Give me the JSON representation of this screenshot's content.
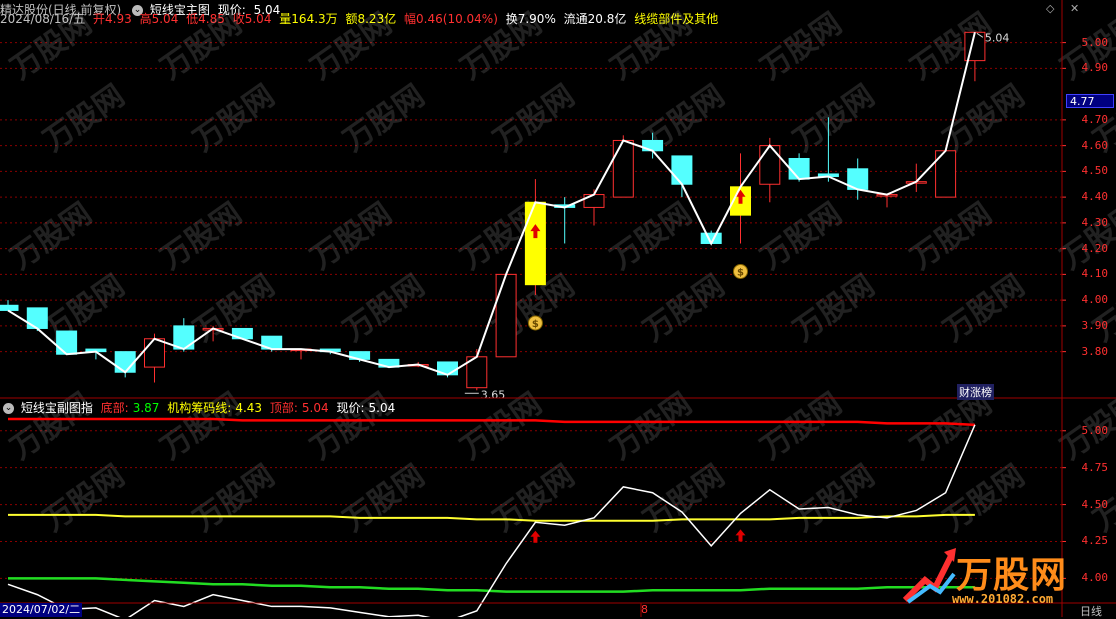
{
  "header": {
    "stock_title": "精达股份(日线,前复权)",
    "indicator_name": "短线宝主图",
    "price_label": "现价:",
    "price_value": "5.04",
    "date": "2024/08/16/五",
    "open": "开4.93",
    "high": "高5.04",
    "low": "低4.85",
    "close": "收5.04",
    "volume": "量164.3万",
    "amount": "额8.23亿",
    "change": "幅0.46(10.04%)",
    "turnover": "换7.90%",
    "float": "流通20.8亿",
    "section": "线缆部件及其他"
  },
  "sub_header": {
    "indicator_name": "短线宝副图指",
    "bottom_label": "底部:",
    "bottom_value": "3.87",
    "inst_label": "机构筹码线:",
    "inst_value": "4.43",
    "top_label": "顶部:",
    "top_value": "5.04",
    "price_label": "现价:",
    "price_value": "5.04"
  },
  "main_axis": [
    "5.00",
    "4.90",
    "4.77",
    "4.70",
    "4.60",
    "4.50",
    "4.40",
    "4.30",
    "4.20",
    "4.10",
    "4.00",
    "3.90",
    "3.80"
  ],
  "current_price_tag": "4.77",
  "sub_axis": [
    "5.00",
    "4.75",
    "4.50",
    "4.25",
    "4.00"
  ],
  "annotations": {
    "high_price": "5.04",
    "low_price": "3.65",
    "caizhang": "财涨榜",
    "date_start": "2024/07/02/二",
    "month_mark": "8",
    "period": "日线"
  },
  "watermark": {
    "brand": "万股网",
    "url": "www.201082.com"
  },
  "colors": {
    "up": "#ff3030",
    "down": "#54ffff",
    "signal": "#ffff00",
    "top_line": "#ff0000",
    "inst_line": "#ffff30",
    "bottom_line": "#22dd22",
    "price_line": "#ffffff"
  },
  "chart_data": {
    "type": "candlestick",
    "candles": [
      {
        "o": 3.98,
        "h": 4.0,
        "l": 3.96,
        "c": 3.96
      },
      {
        "o": 3.97,
        "h": 3.97,
        "l": 3.88,
        "c": 3.89
      },
      {
        "o": 3.88,
        "h": 3.88,
        "l": 3.79,
        "c": 3.79
      },
      {
        "o": 3.81,
        "h": 3.81,
        "l": 3.77,
        "c": 3.8
      },
      {
        "o": 3.8,
        "h": 3.8,
        "l": 3.7,
        "c": 3.72
      },
      {
        "o": 3.74,
        "h": 3.87,
        "l": 3.68,
        "c": 3.85
      },
      {
        "o": 3.9,
        "h": 3.93,
        "l": 3.8,
        "c": 3.81
      },
      {
        "o": 3.89,
        "h": 3.9,
        "l": 3.84,
        "c": 3.89
      },
      {
        "o": 3.89,
        "h": 3.89,
        "l": 3.85,
        "c": 3.85
      },
      {
        "o": 3.86,
        "h": 3.86,
        "l": 3.8,
        "c": 3.81
      },
      {
        "o": 3.81,
        "h": 3.81,
        "l": 3.77,
        "c": 3.81
      },
      {
        "o": 3.81,
        "h": 3.81,
        "l": 3.79,
        "c": 3.8
      },
      {
        "o": 3.8,
        "h": 3.8,
        "l": 3.76,
        "c": 3.77
      },
      {
        "o": 3.77,
        "h": 3.77,
        "l": 3.74,
        "c": 3.74
      },
      {
        "o": 3.75,
        "h": 3.76,
        "l": 3.74,
        "c": 3.75
      },
      {
        "o": 3.76,
        "h": 3.76,
        "l": 3.7,
        "c": 3.71
      },
      {
        "o": 3.66,
        "h": 3.81,
        "l": 3.65,
        "c": 3.78
      },
      {
        "o": 3.78,
        "h": 4.1,
        "l": 3.78,
        "c": 4.1
      },
      {
        "o": 4.06,
        "h": 4.47,
        "l": 4.02,
        "c": 4.38,
        "signal": true
      },
      {
        "o": 4.37,
        "h": 4.4,
        "l": 4.22,
        "c": 4.36
      },
      {
        "o": 4.36,
        "h": 4.43,
        "l": 4.29,
        "c": 4.41
      },
      {
        "o": 4.4,
        "h": 4.64,
        "l": 4.4,
        "c": 4.62
      },
      {
        "o": 4.62,
        "h": 4.65,
        "l": 4.55,
        "c": 4.58
      },
      {
        "o": 4.56,
        "h": 4.56,
        "l": 4.4,
        "c": 4.45
      },
      {
        "o": 4.26,
        "h": 4.27,
        "l": 4.22,
        "c": 4.22
      },
      {
        "o": 4.33,
        "h": 4.57,
        "l": 4.22,
        "c": 4.44,
        "signal": true
      },
      {
        "o": 4.45,
        "h": 4.63,
        "l": 4.38,
        "c": 4.6
      },
      {
        "o": 4.55,
        "h": 4.57,
        "l": 4.46,
        "c": 4.47
      },
      {
        "o": 4.49,
        "h": 4.71,
        "l": 4.46,
        "c": 4.48
      },
      {
        "o": 4.51,
        "h": 4.55,
        "l": 4.39,
        "c": 4.43
      },
      {
        "o": 4.41,
        "h": 4.41,
        "l": 4.36,
        "c": 4.41
      },
      {
        "o": 4.46,
        "h": 4.53,
        "l": 4.42,
        "c": 4.46
      },
      {
        "o": 4.4,
        "h": 4.58,
        "l": 4.4,
        "c": 4.58
      },
      {
        "o": 4.93,
        "h": 5.04,
        "l": 4.85,
        "c": 5.04
      }
    ],
    "main_ylim": [
      3.62,
      5.08
    ],
    "sub": {
      "ylim": [
        3.84,
        5.1
      ],
      "top_line": [
        5.08,
        5.08,
        5.08,
        5.08,
        5.08,
        5.08,
        5.08,
        5.08,
        5.07,
        5.07,
        5.07,
        5.07,
        5.07,
        5.07,
        5.07,
        5.07,
        5.07,
        5.07,
        5.07,
        5.06,
        5.06,
        5.06,
        5.06,
        5.06,
        5.06,
        5.06,
        5.06,
        5.06,
        5.06,
        5.06,
        5.05,
        5.05,
        5.05,
        5.04
      ],
      "inst_line": [
        4.43,
        4.43,
        4.43,
        4.43,
        4.42,
        4.42,
        4.42,
        4.42,
        4.42,
        4.42,
        4.42,
        4.42,
        4.41,
        4.41,
        4.41,
        4.41,
        4.4,
        4.4,
        4.39,
        4.39,
        4.39,
        4.39,
        4.39,
        4.4,
        4.4,
        4.4,
        4.4,
        4.41,
        4.41,
        4.41,
        4.42,
        4.42,
        4.43,
        4.43
      ],
      "bottom_line": [
        4.0,
        4.0,
        4.0,
        4.0,
        3.99,
        3.98,
        3.97,
        3.96,
        3.96,
        3.95,
        3.95,
        3.94,
        3.94,
        3.93,
        3.93,
        3.92,
        3.92,
        3.91,
        3.91,
        3.91,
        3.91,
        3.91,
        3.92,
        3.92,
        3.92,
        3.92,
        3.93,
        3.93,
        3.93,
        3.93,
        3.94,
        3.94,
        3.94,
        3.94
      ]
    }
  }
}
